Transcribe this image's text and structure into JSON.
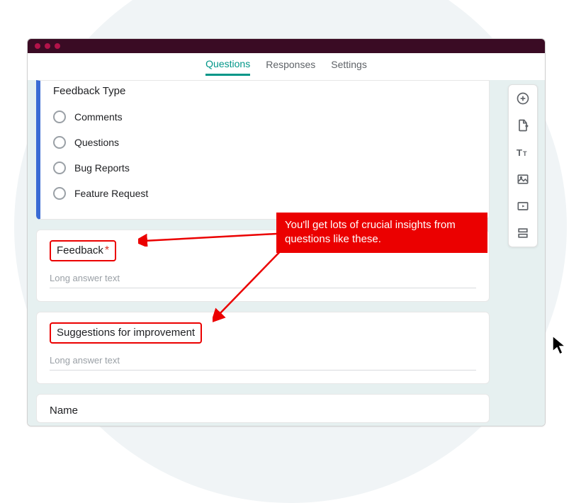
{
  "tabs": {
    "questions": "Questions",
    "responses": "Responses",
    "settings": "Settings"
  },
  "question1": {
    "title": "Feedback Type",
    "options": [
      "Comments",
      "Questions",
      "Bug Reports",
      "Feature Request"
    ]
  },
  "question2": {
    "title": "Feedback",
    "placeholder": "Long answer text",
    "required_mark": "*"
  },
  "question3": {
    "title": "Suggestions for improvement",
    "placeholder": "Long answer text"
  },
  "question4": {
    "title": "Name"
  },
  "callout": {
    "text": "You'll get lots of crucial insights from questions like these."
  },
  "toolbar": {
    "add": "add-question",
    "import": "import-questions",
    "text": "add-title",
    "image": "add-image",
    "video": "add-video",
    "section": "add-section"
  }
}
